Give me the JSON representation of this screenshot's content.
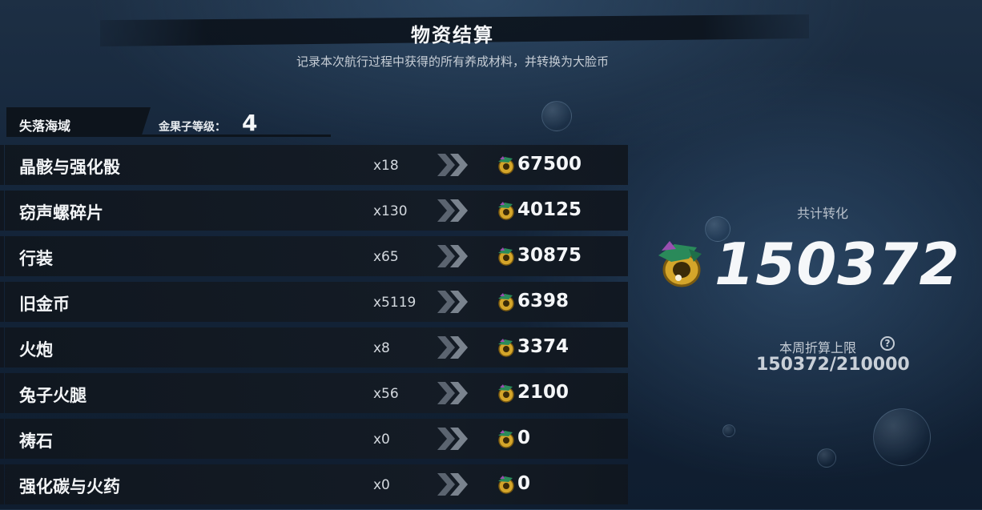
{
  "header": {
    "title": "物资结算",
    "subtitle": "记录本次航行过程中获得的所有养成材料，并转换为大脸币"
  },
  "region": {
    "name": "失落海域",
    "level_label": "金果子等级：",
    "level_value": "4"
  },
  "items": [
    {
      "name": "晶骸与强化骰",
      "qty": "x18",
      "value": "67500"
    },
    {
      "name": "窃声螺碎片",
      "qty": "x130",
      "value": "40125"
    },
    {
      "name": "行装",
      "qty": "x65",
      "value": "30875"
    },
    {
      "name": "旧金币",
      "qty": "x5119",
      "value": "6398"
    },
    {
      "name": "火炮",
      "qty": "x8",
      "value": "3374"
    },
    {
      "name": "兔子火腿",
      "qty": "x56",
      "value": "2100"
    },
    {
      "name": "祷石",
      "qty": "x0",
      "value": "0"
    },
    {
      "name": "强化碳与火药",
      "qty": "x0",
      "value": "0"
    }
  ],
  "summary": {
    "total_label": "共计转化",
    "total_value": "150372",
    "cap_label": "本周折算上限",
    "cap_value": "150372/210000"
  },
  "icons": {
    "coin": "big-face-coin-icon",
    "arrow": "double-chevron-right-icon",
    "help": "question-circle-icon"
  },
  "colors": {
    "background": "#14253a",
    "row_bg": "#10161e",
    "text": "#f2f4f6",
    "coin_gold": "#d4a52a",
    "coin_green": "#2a8a5a",
    "coin_purple": "#9a4fb0"
  }
}
